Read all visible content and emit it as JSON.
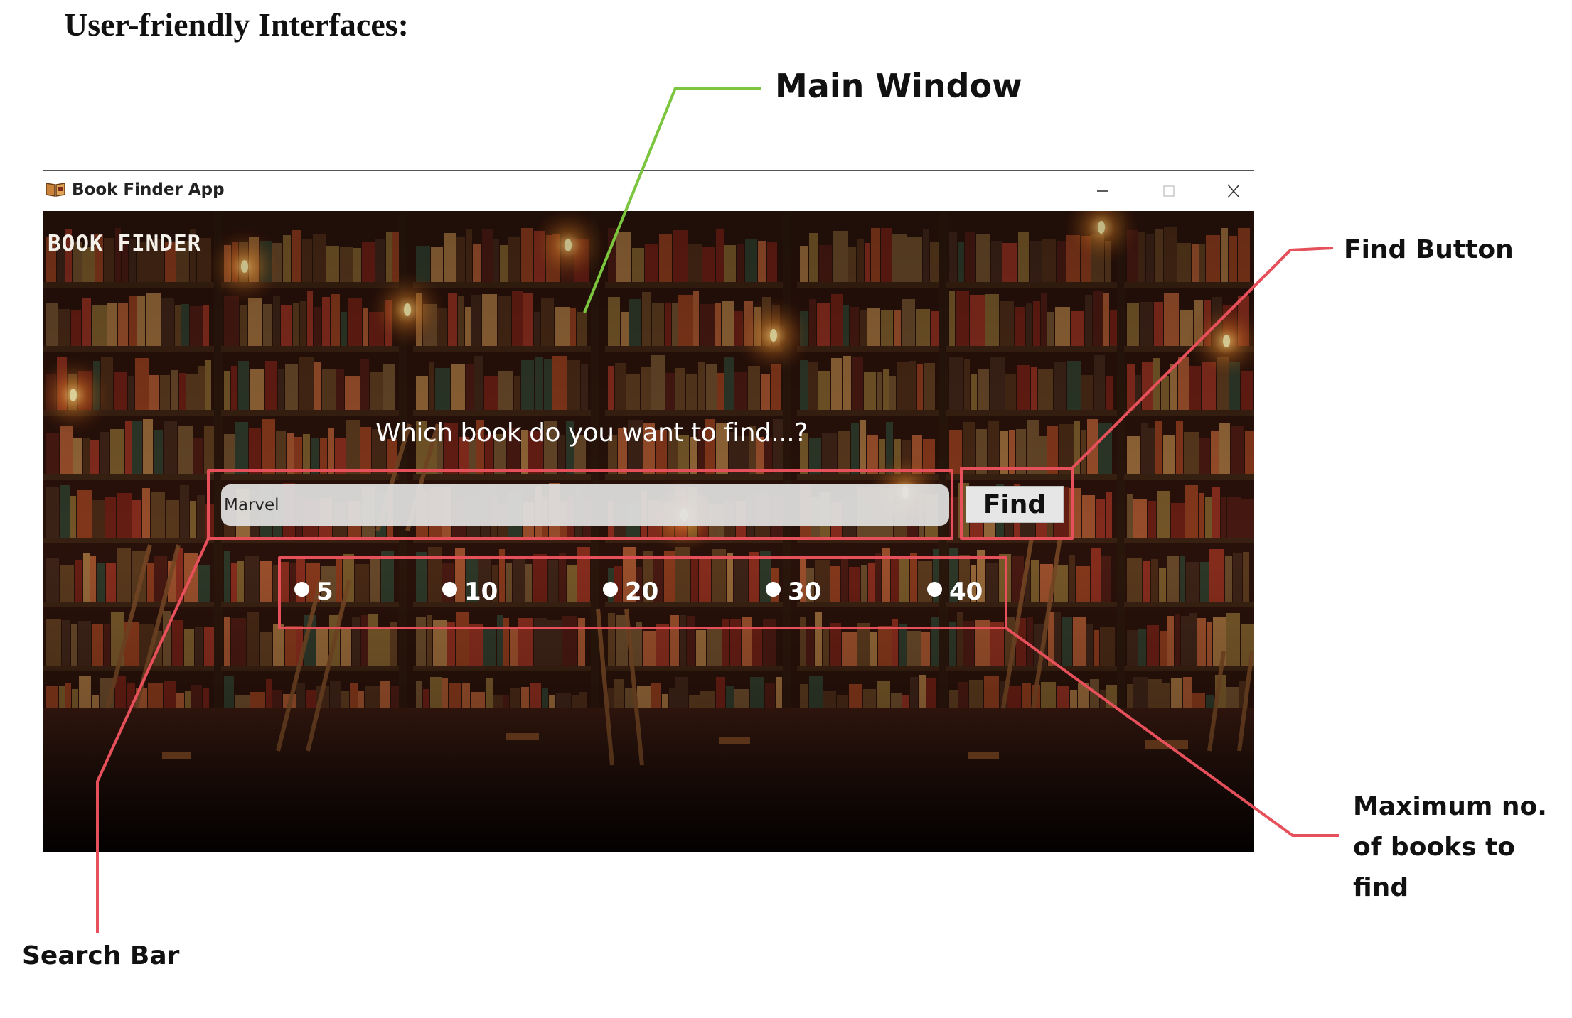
{
  "document": {
    "heading": "User-friendly Interfaces:"
  },
  "window": {
    "title": "Book Finder App",
    "controls": [
      "minimize-icon",
      "maximize-icon",
      "close-icon"
    ]
  },
  "app": {
    "heading": "BOOK FINDER",
    "prompt": "Which book do you want to find...?",
    "search_value": "Marvel",
    "find_label": "Find",
    "max_options": [
      "5",
      "10",
      "20",
      "30",
      "40"
    ]
  },
  "annotations": {
    "main_window": "Main Window",
    "find_button": "Find Button",
    "max_books": "Maximum no. of books to find",
    "search_bar": "Search Bar"
  },
  "colors": {
    "annotation_red": "#e5505a",
    "annotation_green": "#7cc53e"
  }
}
